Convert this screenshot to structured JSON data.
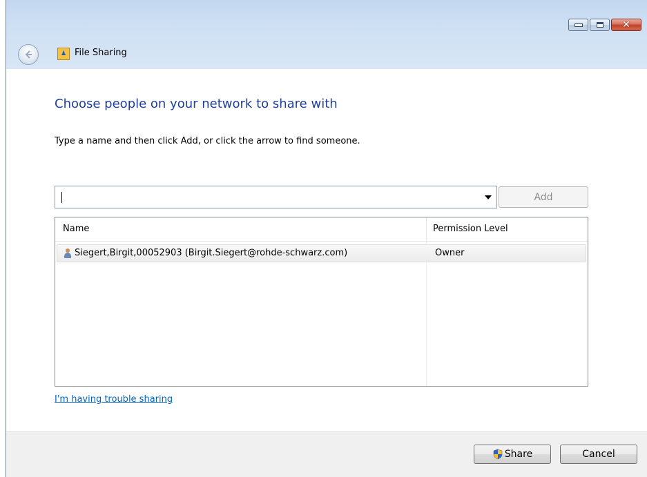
{
  "window": {
    "title": "File Sharing",
    "icon": "people-share-icon",
    "caption_buttons": {
      "minimize": "minimize-icon",
      "maximize": "maximize-icon",
      "close": "close-icon"
    }
  },
  "main": {
    "heading": "Choose people on your network to share with",
    "instruction": "Type a name and then click Add, or click the arrow to find someone.",
    "name_input": {
      "value": "",
      "placeholder": ""
    },
    "add_label": "Add"
  },
  "list": {
    "columns": [
      "Name",
      "Permission Level"
    ],
    "rows": [
      {
        "name": "Siegert,Birgit,00052903 (Birgit.Siegert@rohde-schwarz.com)",
        "permission": "Owner",
        "icon": "user-icon"
      }
    ]
  },
  "help_link": "I'm having trouble sharing",
  "footer": {
    "share_label": "Share",
    "cancel_label": "Cancel"
  },
  "colors": {
    "heading": "#1e3f9e",
    "link": "#0066cc",
    "titlebar": "#cfe0f3"
  }
}
